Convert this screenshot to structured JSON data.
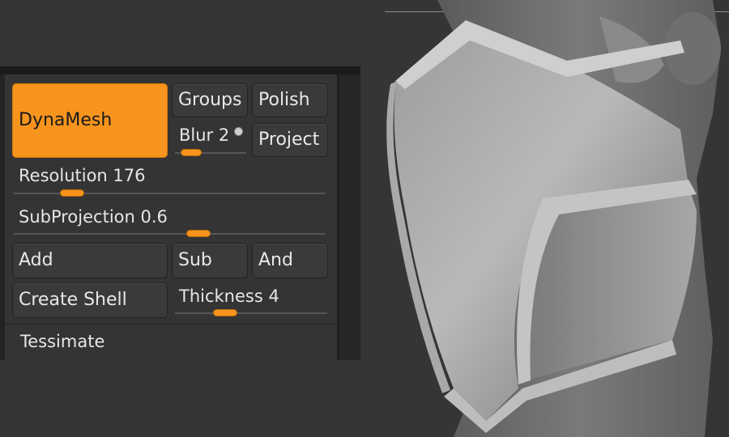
{
  "panel": {
    "dynamesh_label": "DynaMesh",
    "groups_label": "Groups",
    "polish_label": "Polish",
    "blur_label": "Blur",
    "blur_value": "2",
    "blur_fraction": 0.12,
    "project_label": "Project",
    "resolution_label": "Resolution",
    "resolution_value": "176",
    "resolution_fraction": 0.16,
    "subprojection_label": "SubProjection",
    "subprojection_value": "0.6",
    "subprojection_fraction": 0.6,
    "add_label": "Add",
    "sub_label": "Sub",
    "and_label": "And",
    "create_shell_label": "Create Shell",
    "thickness_label": "Thickness",
    "thickness_value": "4",
    "thickness_fraction": 0.3,
    "tessimate_label": "Tessimate"
  },
  "colors": {
    "accent": "#f7941d",
    "panel_bg": "#343434",
    "button_bg": "#3a3a3a",
    "viewport_bg": "#353535"
  }
}
